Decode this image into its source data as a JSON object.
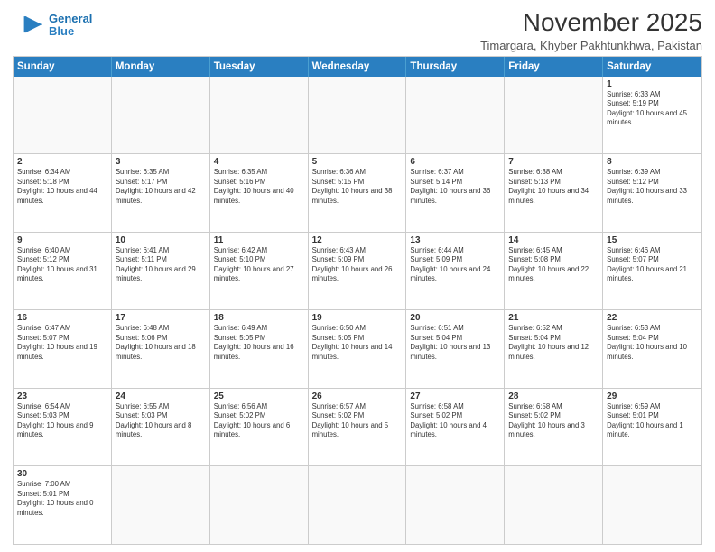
{
  "logo": {
    "line1": "General",
    "line2": "Blue"
  },
  "header": {
    "month_year": "November 2025",
    "location": "Timargara, Khyber Pakhtunkhwa, Pakistan"
  },
  "days_of_week": [
    "Sunday",
    "Monday",
    "Tuesday",
    "Wednesday",
    "Thursday",
    "Friday",
    "Saturday"
  ],
  "rows": [
    [
      {
        "day": "",
        "info": ""
      },
      {
        "day": "",
        "info": ""
      },
      {
        "day": "",
        "info": ""
      },
      {
        "day": "",
        "info": ""
      },
      {
        "day": "",
        "info": ""
      },
      {
        "day": "",
        "info": ""
      },
      {
        "day": "1",
        "info": "Sunrise: 6:33 AM\nSunset: 5:19 PM\nDaylight: 10 hours and 45 minutes."
      }
    ],
    [
      {
        "day": "2",
        "info": "Sunrise: 6:34 AM\nSunset: 5:18 PM\nDaylight: 10 hours and 44 minutes."
      },
      {
        "day": "3",
        "info": "Sunrise: 6:35 AM\nSunset: 5:17 PM\nDaylight: 10 hours and 42 minutes."
      },
      {
        "day": "4",
        "info": "Sunrise: 6:35 AM\nSunset: 5:16 PM\nDaylight: 10 hours and 40 minutes."
      },
      {
        "day": "5",
        "info": "Sunrise: 6:36 AM\nSunset: 5:15 PM\nDaylight: 10 hours and 38 minutes."
      },
      {
        "day": "6",
        "info": "Sunrise: 6:37 AM\nSunset: 5:14 PM\nDaylight: 10 hours and 36 minutes."
      },
      {
        "day": "7",
        "info": "Sunrise: 6:38 AM\nSunset: 5:13 PM\nDaylight: 10 hours and 34 minutes."
      },
      {
        "day": "8",
        "info": "Sunrise: 6:39 AM\nSunset: 5:12 PM\nDaylight: 10 hours and 33 minutes."
      }
    ],
    [
      {
        "day": "9",
        "info": "Sunrise: 6:40 AM\nSunset: 5:12 PM\nDaylight: 10 hours and 31 minutes."
      },
      {
        "day": "10",
        "info": "Sunrise: 6:41 AM\nSunset: 5:11 PM\nDaylight: 10 hours and 29 minutes."
      },
      {
        "day": "11",
        "info": "Sunrise: 6:42 AM\nSunset: 5:10 PM\nDaylight: 10 hours and 27 minutes."
      },
      {
        "day": "12",
        "info": "Sunrise: 6:43 AM\nSunset: 5:09 PM\nDaylight: 10 hours and 26 minutes."
      },
      {
        "day": "13",
        "info": "Sunrise: 6:44 AM\nSunset: 5:09 PM\nDaylight: 10 hours and 24 minutes."
      },
      {
        "day": "14",
        "info": "Sunrise: 6:45 AM\nSunset: 5:08 PM\nDaylight: 10 hours and 22 minutes."
      },
      {
        "day": "15",
        "info": "Sunrise: 6:46 AM\nSunset: 5:07 PM\nDaylight: 10 hours and 21 minutes."
      }
    ],
    [
      {
        "day": "16",
        "info": "Sunrise: 6:47 AM\nSunset: 5:07 PM\nDaylight: 10 hours and 19 minutes."
      },
      {
        "day": "17",
        "info": "Sunrise: 6:48 AM\nSunset: 5:06 PM\nDaylight: 10 hours and 18 minutes."
      },
      {
        "day": "18",
        "info": "Sunrise: 6:49 AM\nSunset: 5:05 PM\nDaylight: 10 hours and 16 minutes."
      },
      {
        "day": "19",
        "info": "Sunrise: 6:50 AM\nSunset: 5:05 PM\nDaylight: 10 hours and 14 minutes."
      },
      {
        "day": "20",
        "info": "Sunrise: 6:51 AM\nSunset: 5:04 PM\nDaylight: 10 hours and 13 minutes."
      },
      {
        "day": "21",
        "info": "Sunrise: 6:52 AM\nSunset: 5:04 PM\nDaylight: 10 hours and 12 minutes."
      },
      {
        "day": "22",
        "info": "Sunrise: 6:53 AM\nSunset: 5:04 PM\nDaylight: 10 hours and 10 minutes."
      }
    ],
    [
      {
        "day": "23",
        "info": "Sunrise: 6:54 AM\nSunset: 5:03 PM\nDaylight: 10 hours and 9 minutes."
      },
      {
        "day": "24",
        "info": "Sunrise: 6:55 AM\nSunset: 5:03 PM\nDaylight: 10 hours and 8 minutes."
      },
      {
        "day": "25",
        "info": "Sunrise: 6:56 AM\nSunset: 5:02 PM\nDaylight: 10 hours and 6 minutes."
      },
      {
        "day": "26",
        "info": "Sunrise: 6:57 AM\nSunset: 5:02 PM\nDaylight: 10 hours and 5 minutes."
      },
      {
        "day": "27",
        "info": "Sunrise: 6:58 AM\nSunset: 5:02 PM\nDaylight: 10 hours and 4 minutes."
      },
      {
        "day": "28",
        "info": "Sunrise: 6:58 AM\nSunset: 5:02 PM\nDaylight: 10 hours and 3 minutes."
      },
      {
        "day": "29",
        "info": "Sunrise: 6:59 AM\nSunset: 5:01 PM\nDaylight: 10 hours and 1 minute."
      }
    ],
    [
      {
        "day": "30",
        "info": "Sunrise: 7:00 AM\nSunset: 5:01 PM\nDaylight: 10 hours and 0 minutes."
      },
      {
        "day": "",
        "info": ""
      },
      {
        "day": "",
        "info": ""
      },
      {
        "day": "",
        "info": ""
      },
      {
        "day": "",
        "info": ""
      },
      {
        "day": "",
        "info": ""
      },
      {
        "day": "",
        "info": ""
      }
    ]
  ]
}
